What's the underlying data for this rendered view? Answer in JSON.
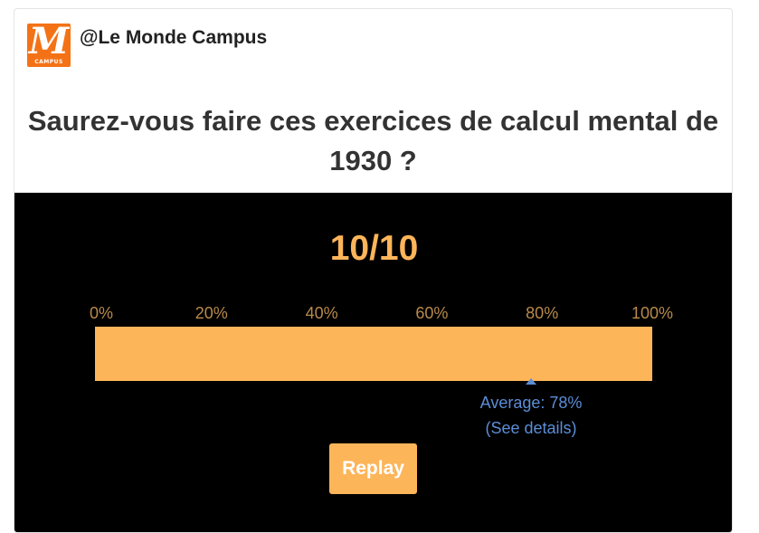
{
  "header": {
    "logo_text": "M",
    "logo_subtext": "CAMPUS",
    "account_name": "@Le Monde Campus"
  },
  "quiz": {
    "title": "Saurez-vous faire ces exercices de calcul mental de 1930 ?",
    "score": "10/10",
    "score_fraction": 1.0,
    "scale_ticks": [
      "0%",
      "20%",
      "40%",
      "60%",
      "80%",
      "100%"
    ],
    "average_value": 0.78,
    "average_label": "Average: 78%",
    "details_link": "(See details)",
    "replay_label": "Replay"
  },
  "colors": {
    "accent": "#fdb55a",
    "logo_bg": "#f47216",
    "average": "#5b8ed6",
    "panel_bg": "#000000"
  }
}
